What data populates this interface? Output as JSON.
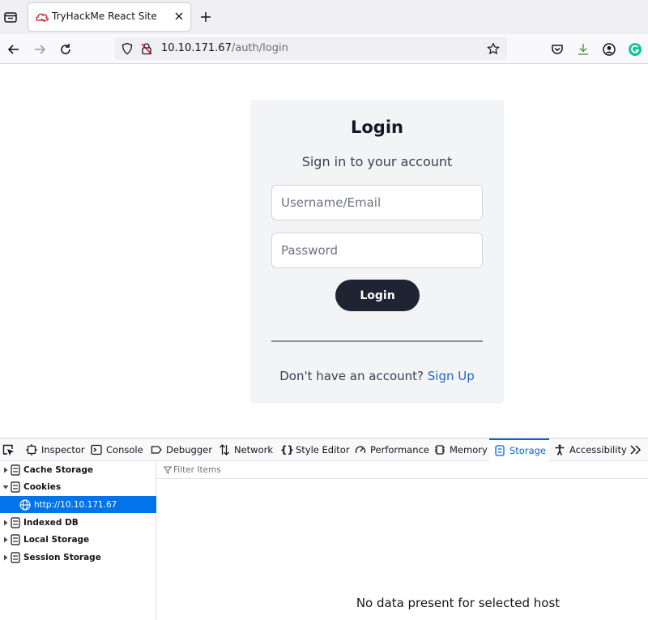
{
  "browser": {
    "tab_title": "TryHackMe React Site",
    "url_host": "10.10.171.67",
    "url_path": "/auth/login"
  },
  "login_page": {
    "title": "Login",
    "subtitle": "Sign in to your account",
    "username_placeholder": "Username/Email",
    "password_placeholder": "Password",
    "login_button": "Login",
    "signup_prompt": "Don't have an account?",
    "signup_link": "Sign Up"
  },
  "devtools": {
    "tabs": [
      {
        "label": "Inspector",
        "icon": "inspector-icon"
      },
      {
        "label": "Console",
        "icon": "console-icon"
      },
      {
        "label": "Debugger",
        "icon": "debugger-icon"
      },
      {
        "label": "Network",
        "icon": "network-icon"
      },
      {
        "label": "Style Editor",
        "icon": "style-editor-icon"
      },
      {
        "label": "Performance",
        "icon": "performance-icon"
      },
      {
        "label": "Memory",
        "icon": "memory-icon"
      },
      {
        "label": "Storage",
        "icon": "storage-icon",
        "selected": true
      },
      {
        "label": "Accessibility",
        "icon": "accessibility-icon"
      }
    ],
    "storage_tree": [
      {
        "label": "Cache Storage",
        "expanded": false
      },
      {
        "label": "Cookies",
        "expanded": true
      },
      {
        "label": "http://10.10.171.67",
        "child": true,
        "selected": true
      },
      {
        "label": "Indexed DB",
        "expanded": false
      },
      {
        "label": "Local Storage",
        "expanded": false
      },
      {
        "label": "Session Storage",
        "expanded": false
      }
    ],
    "filter_placeholder": "Filter Items",
    "empty_message": "No data present for selected host"
  },
  "colors": {
    "accent": "#0060df",
    "login_button_bg": "#1f2433",
    "signup_link": "#2563c9",
    "selected_row": "#0074e8"
  }
}
